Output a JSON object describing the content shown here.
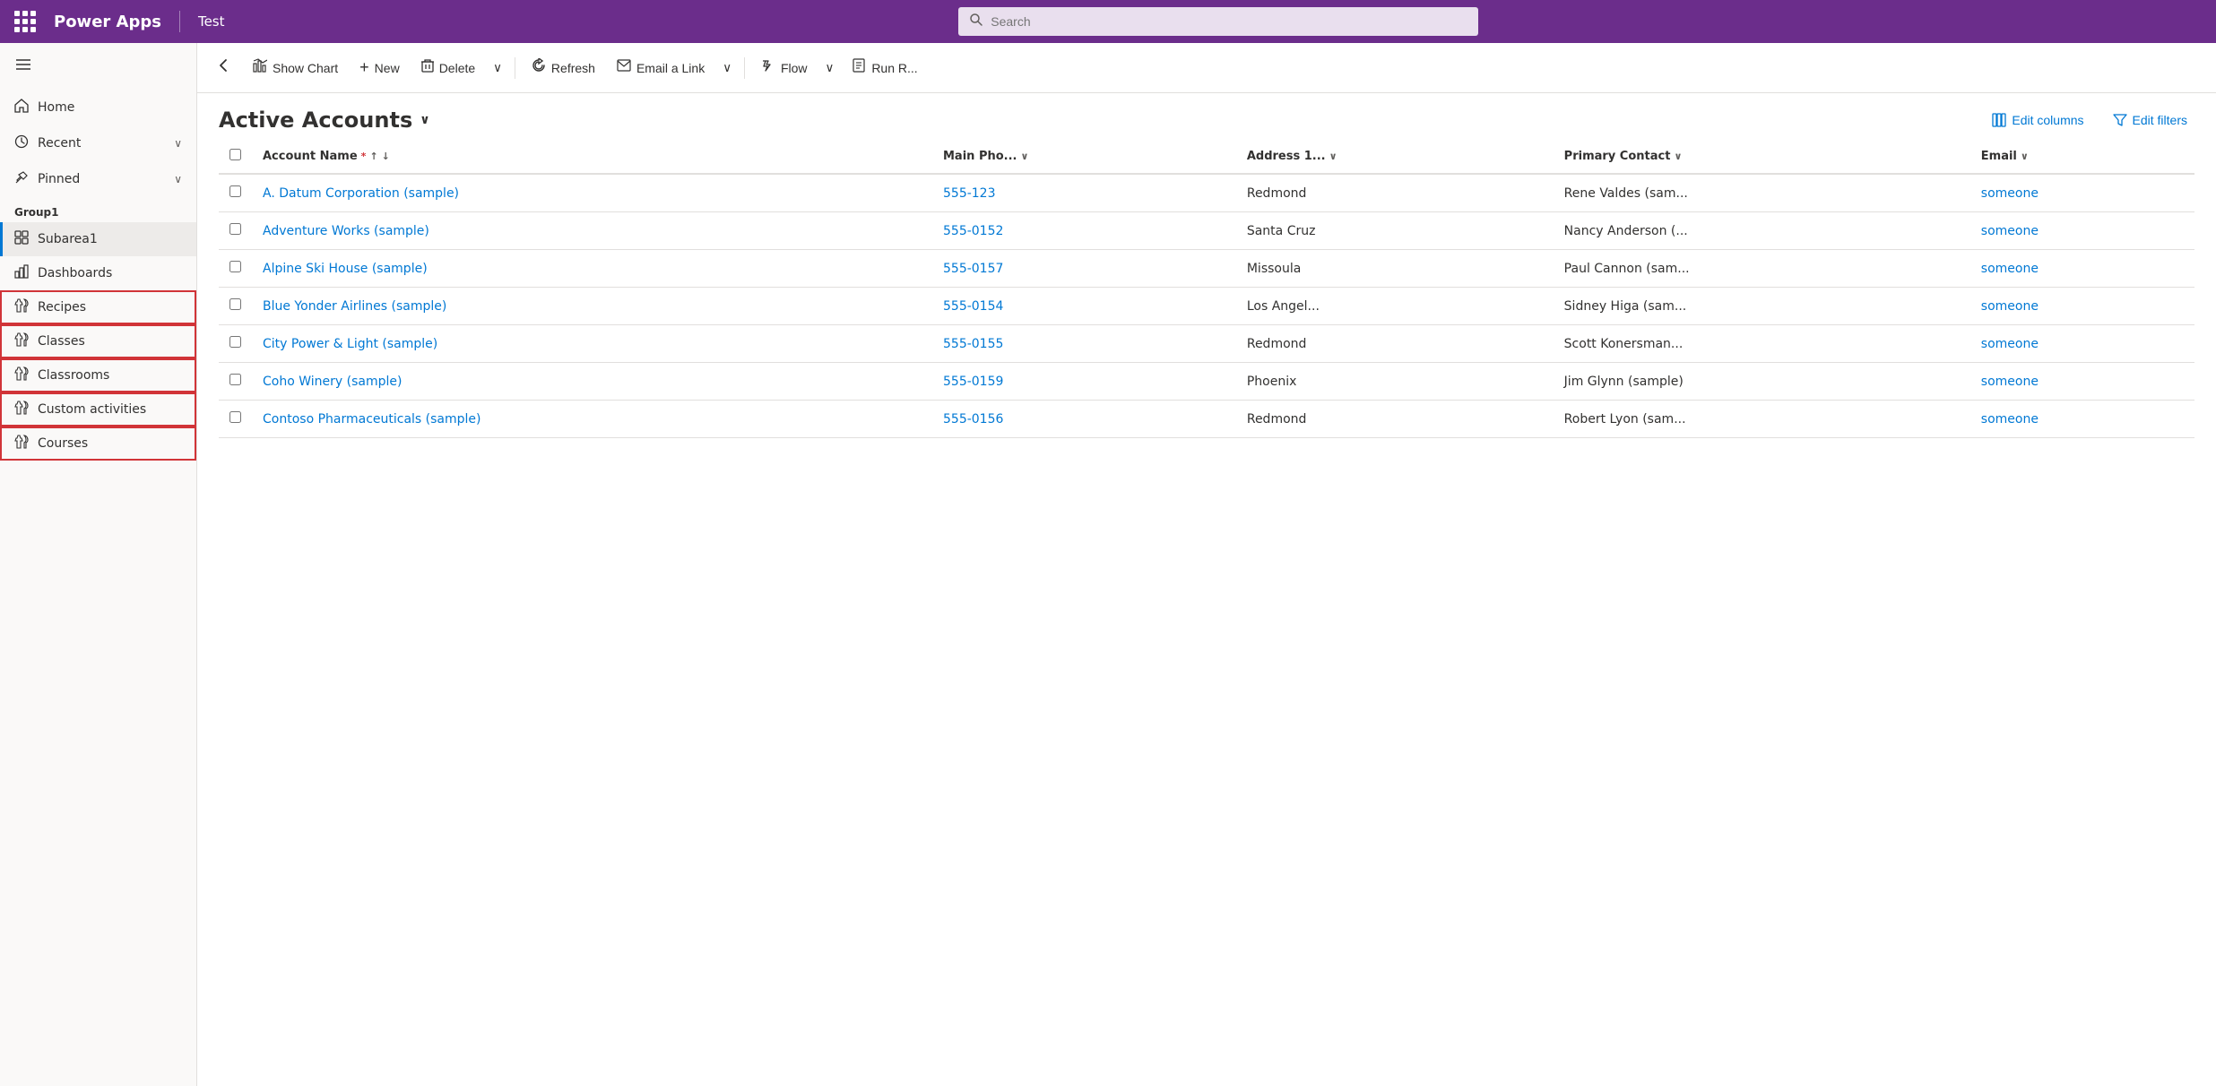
{
  "app": {
    "brand": "Power Apps",
    "instance": "Test",
    "search_placeholder": "Search"
  },
  "toolbar": {
    "back_label": "←",
    "show_chart_label": "Show Chart",
    "new_label": "New",
    "delete_label": "Delete",
    "refresh_label": "Refresh",
    "email_link_label": "Email a Link",
    "flow_label": "Flow",
    "run_report_label": "Run R..."
  },
  "sidebar": {
    "hamburger_label": "☰",
    "nav_items": [
      {
        "id": "home",
        "label": "Home",
        "icon": "⌂"
      },
      {
        "id": "recent",
        "label": "Recent",
        "icon": "🕐",
        "has_chevron": true
      },
      {
        "id": "pinned",
        "label": "Pinned",
        "icon": "📌",
        "has_chevron": true
      }
    ],
    "group_label": "Group1",
    "group_items": [
      {
        "id": "subarea1",
        "label": "Subarea1",
        "icon": "▦",
        "active": true
      },
      {
        "id": "dashboards",
        "label": "Dashboards",
        "icon": "📊"
      },
      {
        "id": "recipes",
        "label": "Recipes",
        "icon": "puzzle",
        "highlighted": true
      },
      {
        "id": "classes",
        "label": "Classes",
        "icon": "puzzle",
        "highlighted": true
      },
      {
        "id": "classrooms",
        "label": "Classrooms",
        "icon": "puzzle",
        "highlighted": true
      },
      {
        "id": "custom-activities",
        "label": "Custom activities",
        "icon": "puzzle",
        "highlighted": true
      },
      {
        "id": "courses",
        "label": "Courses",
        "icon": "puzzle",
        "highlighted": true
      }
    ]
  },
  "list": {
    "title": "Active Accounts",
    "edit_columns_label": "Edit columns",
    "edit_filters_label": "Edit filters",
    "columns": [
      {
        "id": "account-name",
        "label": "Account Name",
        "required": true,
        "sortable": true
      },
      {
        "id": "main-phone",
        "label": "Main Pho...",
        "sortable": false,
        "has_chevron": true
      },
      {
        "id": "address",
        "label": "Address 1...",
        "sortable": false,
        "has_chevron": true
      },
      {
        "id": "primary-contact",
        "label": "Primary Contact",
        "sortable": false,
        "has_chevron": true
      },
      {
        "id": "email",
        "label": "Email",
        "sortable": false,
        "has_chevron": true
      }
    ],
    "rows": [
      {
        "account_name": "A. Datum Corporation (sample)",
        "main_phone": "555-123",
        "address": "Redmond",
        "primary_contact": "Rene Valdes (sam...",
        "email": "someone"
      },
      {
        "account_name": "Adventure Works (sample)",
        "main_phone": "555-0152",
        "address": "Santa Cruz",
        "primary_contact": "Nancy Anderson (...",
        "email": "someone"
      },
      {
        "account_name": "Alpine Ski House (sample)",
        "main_phone": "555-0157",
        "address": "Missoula",
        "primary_contact": "Paul Cannon (sam...",
        "email": "someone"
      },
      {
        "account_name": "Blue Yonder Airlines (sample)",
        "main_phone": "555-0154",
        "address": "Los Angel...",
        "primary_contact": "Sidney Higa (sam...",
        "email": "someone"
      },
      {
        "account_name": "City Power & Light (sample)",
        "main_phone": "555-0155",
        "address": "Redmond",
        "primary_contact": "Scott Konersman...",
        "email": "someone"
      },
      {
        "account_name": "Coho Winery (sample)",
        "main_phone": "555-0159",
        "address": "Phoenix",
        "primary_contact": "Jim Glynn (sample)",
        "email": "someone"
      },
      {
        "account_name": "Contoso Pharmaceuticals (sample)",
        "main_phone": "555-0156",
        "address": "Redmond",
        "primary_contact": "Robert Lyon (sam...",
        "email": "someone"
      }
    ]
  }
}
